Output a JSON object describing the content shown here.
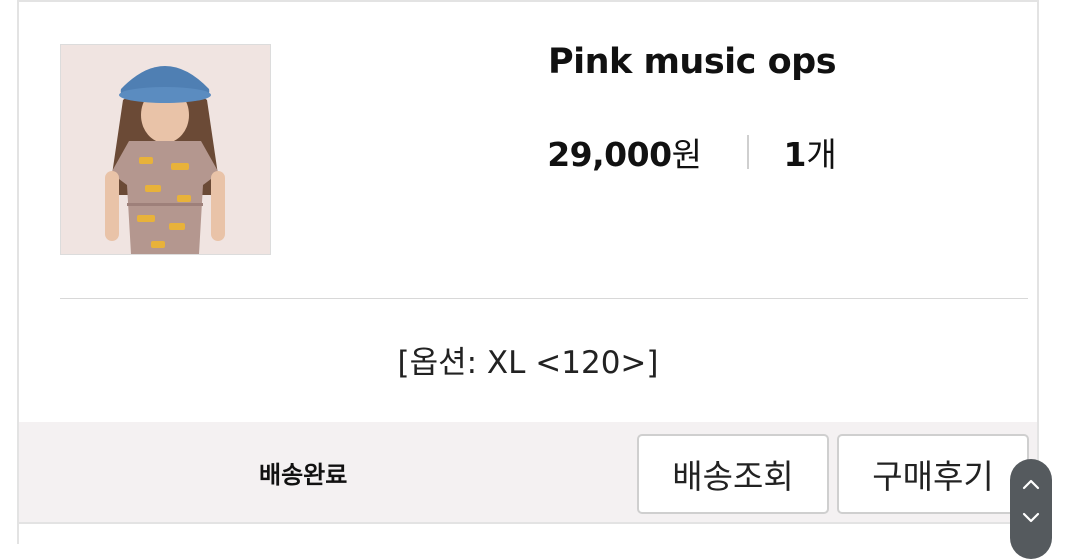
{
  "product": {
    "title": "Pink music ops",
    "price_number": "29,000",
    "price_unit": "원",
    "quantity_number": "1",
    "quantity_unit": "개",
    "option_text": "[옵션: XL <120>]",
    "image_icon": "product-photo"
  },
  "footer": {
    "status": "배송완료",
    "track_button": "배송조회",
    "review_button": "구매후기"
  },
  "scroll": {
    "up_icon": "chevron-up-icon",
    "down_icon": "chevron-down-icon"
  },
  "colors": {
    "footer_bg": "#f4f1f2",
    "border": "#e3e3e3",
    "scroll_widget": "#555a5e"
  }
}
